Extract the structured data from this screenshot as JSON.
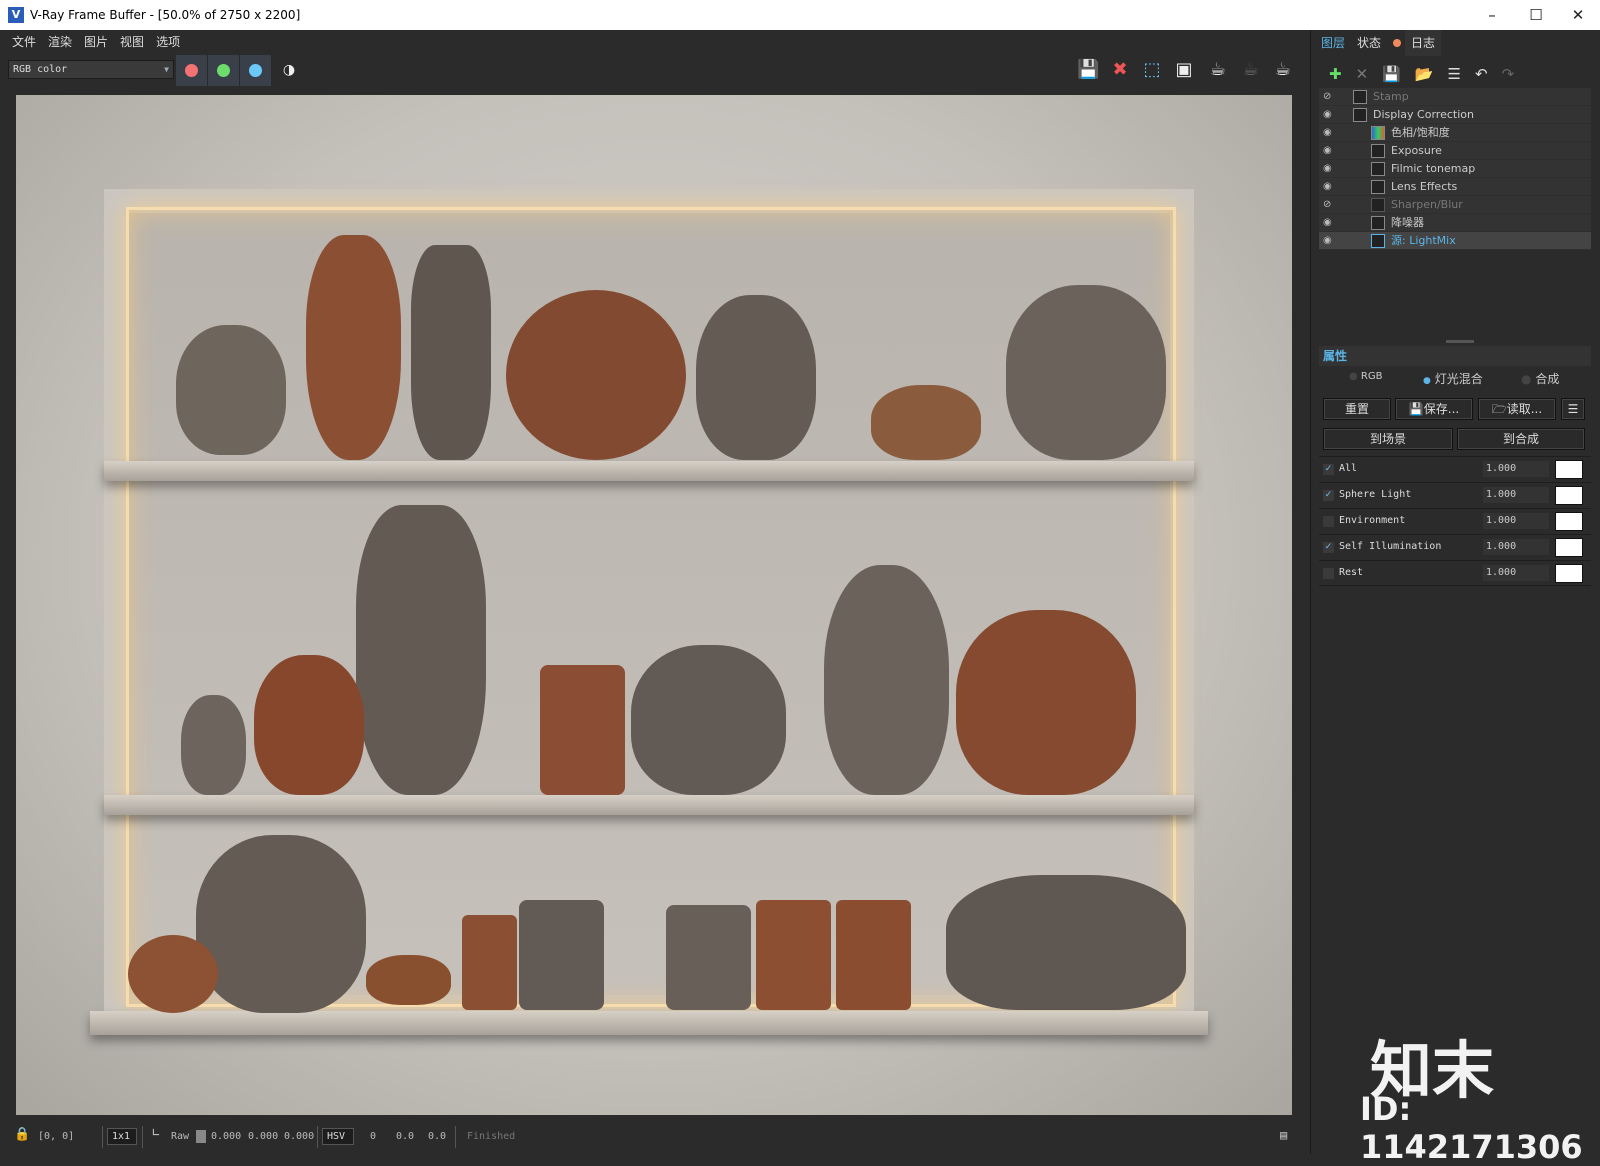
{
  "window": {
    "title": "V-Ray Frame Buffer - [50.0% of 2750 x 2200]",
    "icon": "vray-logo-icon",
    "controls": [
      "minimize",
      "maximize",
      "close"
    ]
  },
  "menu": [
    "文件",
    "渲染",
    "图片",
    "视图",
    "选项"
  ],
  "toolbar": {
    "channel": "RGB color",
    "channel_buttons": [
      {
        "name": "red",
        "color": "#f47272"
      },
      {
        "name": "green",
        "color": "#6ddc6d"
      },
      {
        "name": "blue",
        "color": "#6cc8f7"
      }
    ],
    "right_icons": [
      "save-image-icon",
      "clear-image-icon",
      "region-render-icon",
      "track-mouse-icon",
      "render-last-icon",
      "render-interactive-icon",
      "render-icon"
    ]
  },
  "right_panel": {
    "tabs": [
      "图层",
      "状态",
      "日志"
    ],
    "log_dot_color": "#f08a5d",
    "layer_tools": [
      "add-layer-icon",
      "delete-layer-icon",
      "save-layers-icon",
      "load-layers-icon",
      "layer-list-icon",
      "undo-icon",
      "redo-icon"
    ],
    "layers": [
      {
        "name": "Stamp",
        "visible": false,
        "indent": 0
      },
      {
        "name": "Display Correction",
        "visible": true,
        "indent": 0
      },
      {
        "name": "色相/饱和度",
        "visible": true,
        "indent": 1
      },
      {
        "name": "Exposure",
        "visible": true,
        "indent": 1
      },
      {
        "name": "Filmic tonemap",
        "visible": true,
        "indent": 1
      },
      {
        "name": "Lens Effects",
        "visible": true,
        "indent": 1
      },
      {
        "name": "Sharpen/Blur",
        "visible": false,
        "indent": 1
      },
      {
        "name": "降噪器",
        "visible": true,
        "indent": 1
      },
      {
        "name": "源: LightMix",
        "visible": true,
        "indent": 1,
        "selected": true
      }
    ],
    "properties_title": "属性",
    "modes": [
      {
        "label": "RGB",
        "selected": false
      },
      {
        "label": "灯光混合",
        "selected": true
      },
      {
        "label": "合成",
        "selected": false
      }
    ],
    "buttons": {
      "reset": "重置",
      "save": "保存...",
      "load": "读取...",
      "to_scene": "到场景",
      "to_composite": "到合成"
    },
    "lights": [
      {
        "name": "All",
        "checked": true,
        "value": "1.000",
        "color": "#ffffff"
      },
      {
        "name": "Sphere Light",
        "checked": true,
        "value": "1.000",
        "color": "#ffffff"
      },
      {
        "name": "Environment",
        "checked": false,
        "value": "1.000",
        "color": "#ffffff"
      },
      {
        "name": "Self Illumination",
        "checked": true,
        "value": "1.000",
        "color": "#ffffff"
      },
      {
        "name": "Rest",
        "checked": false,
        "value": "1.000",
        "color": "#ffffff"
      }
    ]
  },
  "statusbar": {
    "coords": "[0, 0]",
    "zoom": "1x1",
    "raw": "Raw",
    "rgb": [
      "0.000",
      "0.000",
      "0.000"
    ],
    "color_mode": "HSV",
    "hsv": [
      "0",
      "0.0",
      "0.0"
    ],
    "status": "Finished"
  },
  "watermark": {
    "logo": "知末",
    "id": "ID: 1142171306"
  }
}
